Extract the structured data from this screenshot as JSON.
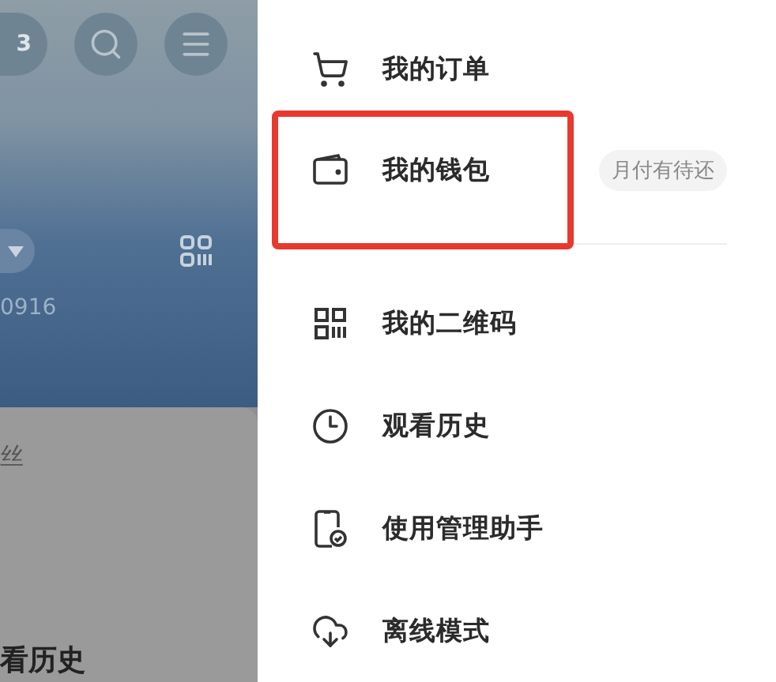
{
  "background_screen": {
    "tab_count": "3",
    "account_suffix": "0916",
    "fans_label": "丝",
    "history_label": "看历史"
  },
  "drawer": {
    "sections": [
      [
        {
          "kind": "cart",
          "label": "我的订单",
          "highlighted": false
        },
        {
          "kind": "wallet",
          "label": "我的钱包",
          "badge": "月付有待还",
          "highlighted": true
        }
      ],
      [
        {
          "kind": "qr",
          "label": "我的二维码",
          "highlighted": false
        },
        {
          "kind": "clock",
          "label": "观看历史",
          "highlighted": false
        },
        {
          "kind": "phone",
          "label": "使用管理助手",
          "highlighted": false
        },
        {
          "kind": "cloud",
          "label": "离线模式",
          "highlighted": false
        }
      ]
    ]
  }
}
